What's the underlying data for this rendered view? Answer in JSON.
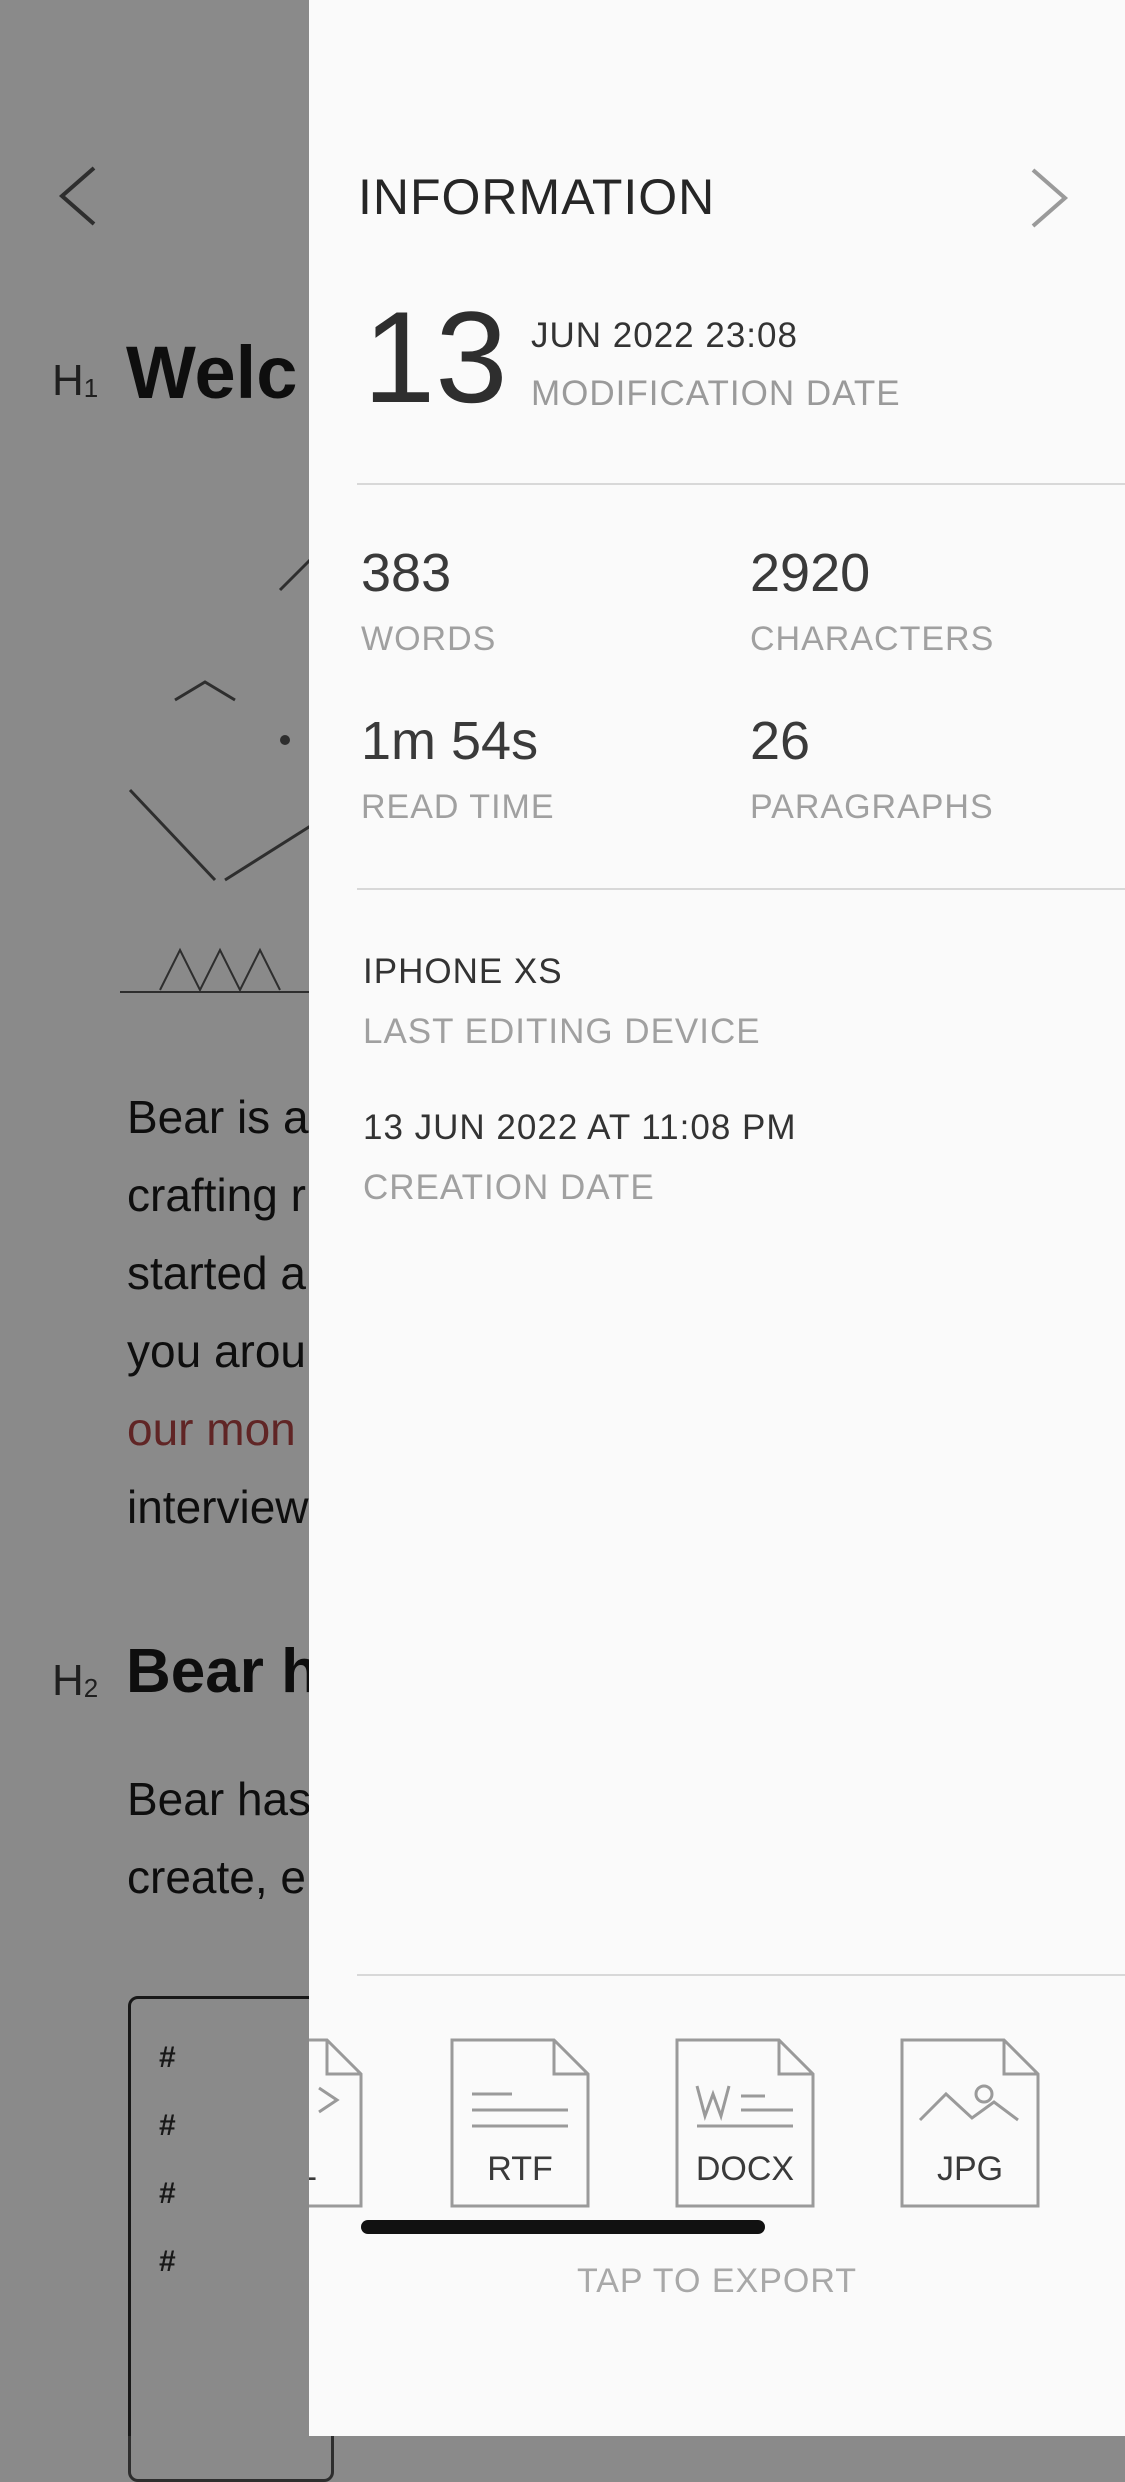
{
  "note": {
    "h1_marker": "H",
    "h1_level": "1",
    "h1_text": "Welc",
    "h2_marker": "H",
    "h2_level": "2",
    "h2_text": "Bear h",
    "paragraph1": [
      "Bear is a",
      "crafting r",
      "started a",
      "you arou",
      "our mon",
      "interview"
    ],
    "paragraph2": [
      "Bear has",
      "create, e"
    ],
    "hashes": [
      "#",
      "#",
      "#",
      "#"
    ]
  },
  "panel": {
    "title": "INFORMATION",
    "modification": {
      "day": "13",
      "date_time": "JUN 2022 23:08",
      "label": "MODIFICATION DATE"
    },
    "stats": [
      {
        "value": "383",
        "label": "WORDS"
      },
      {
        "value": "2920",
        "label": "CHARACTERS"
      },
      {
        "value": "1m 54s",
        "label": "READ TIME"
      },
      {
        "value": "26",
        "label": "PARAGRAPHS"
      }
    ],
    "device": {
      "value": "IPHONE XS",
      "label": "LAST EDITING DEVICE"
    },
    "creation": {
      "value": "13 JUN 2022 AT 11:08 PM",
      "label": "CREATION DATE"
    },
    "exports": [
      {
        "label": "ML",
        "icon": "html-file-icon"
      },
      {
        "label": "RTF",
        "icon": "rtf-file-icon"
      },
      {
        "label": "DOCX",
        "icon": "docx-file-icon"
      },
      {
        "label": "JPG",
        "icon": "jpg-file-icon"
      }
    ],
    "export_hint": "TAP TO EXPORT"
  },
  "colors": {
    "panel_bg": "#fafafa",
    "link": "#b14545",
    "dim_overlay": "rgba(0,0,0,0.46)"
  }
}
